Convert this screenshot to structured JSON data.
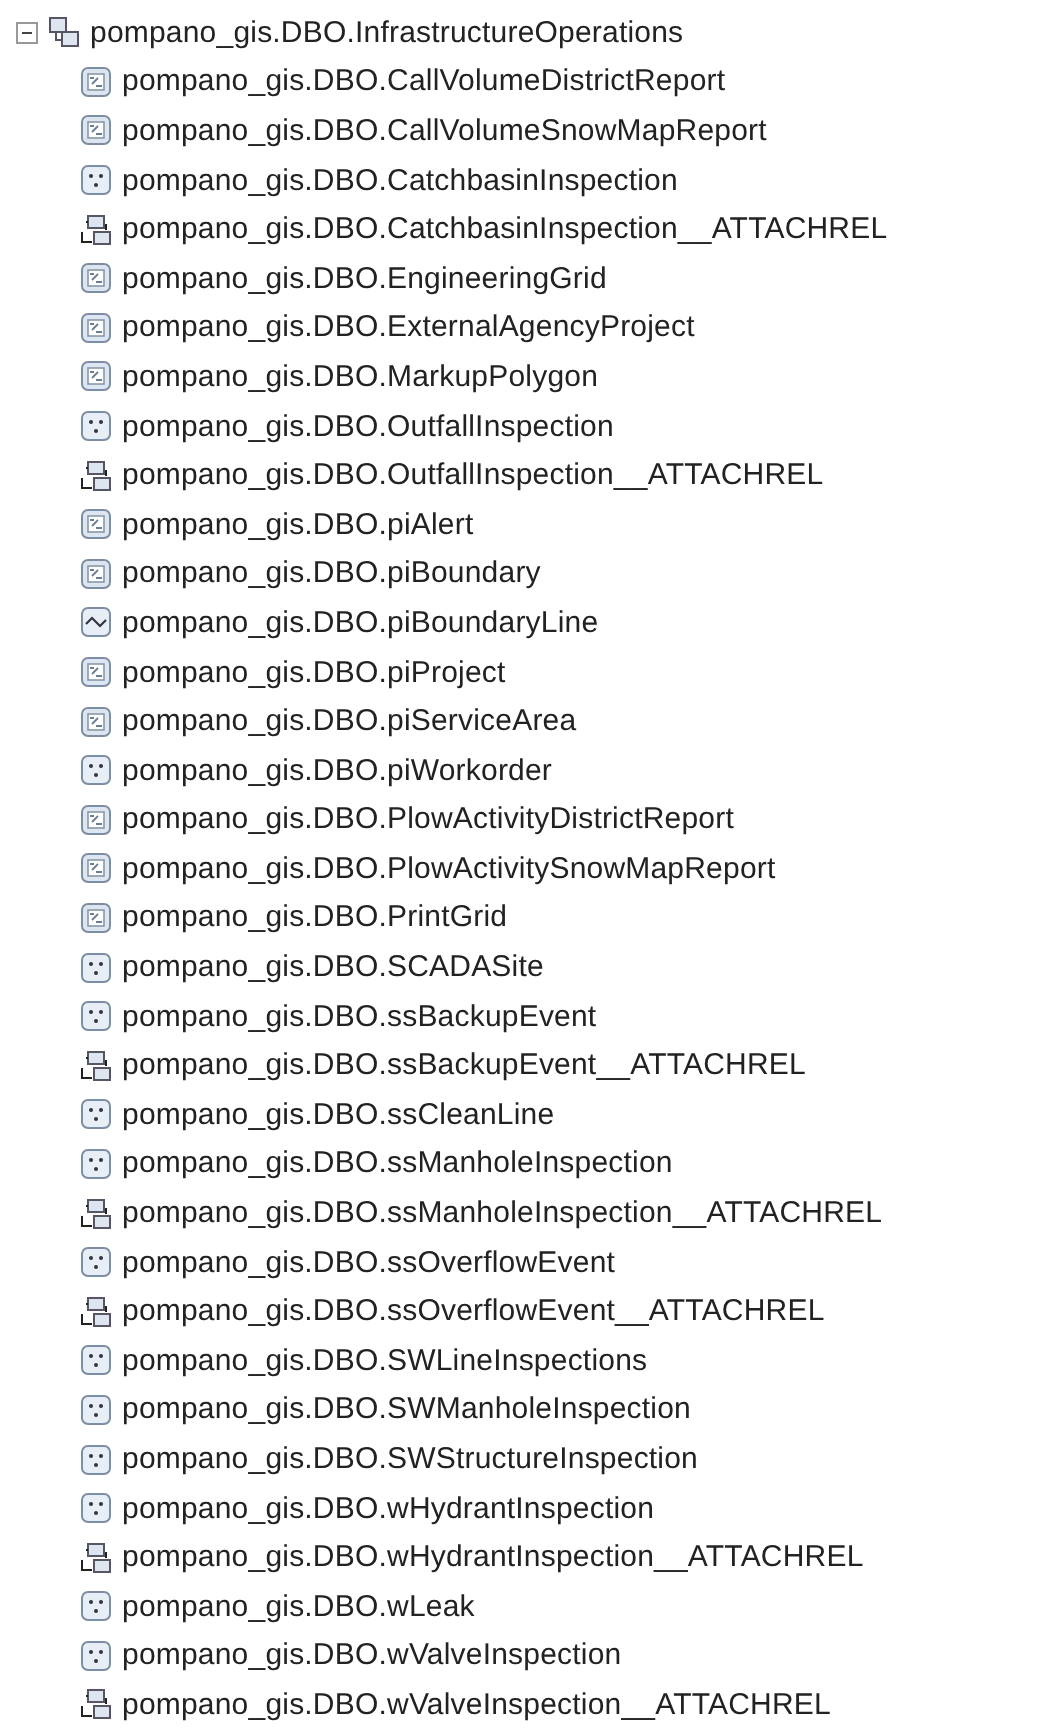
{
  "tree": {
    "label": "pompano_gis.DBO.InfrastructureOperations",
    "kind": "dataset",
    "expanded": true,
    "children": [
      {
        "label": "pompano_gis.DBO.CallVolumeDistrictReport",
        "kind": "table"
      },
      {
        "label": "pompano_gis.DBO.CallVolumeSnowMapReport",
        "kind": "table"
      },
      {
        "label": "pompano_gis.DBO.CatchbasinInspection",
        "kind": "point"
      },
      {
        "label": "pompano_gis.DBO.CatchbasinInspection__ATTACHREL",
        "kind": "relationship"
      },
      {
        "label": "pompano_gis.DBO.EngineeringGrid",
        "kind": "table"
      },
      {
        "label": "pompano_gis.DBO.ExternalAgencyProject",
        "kind": "table"
      },
      {
        "label": "pompano_gis.DBO.MarkupPolygon",
        "kind": "table"
      },
      {
        "label": "pompano_gis.DBO.OutfallInspection",
        "kind": "point"
      },
      {
        "label": "pompano_gis.DBO.OutfallInspection__ATTACHREL",
        "kind": "relationship"
      },
      {
        "label": "pompano_gis.DBO.piAlert",
        "kind": "table"
      },
      {
        "label": "pompano_gis.DBO.piBoundary",
        "kind": "table"
      },
      {
        "label": "pompano_gis.DBO.piBoundaryLine",
        "kind": "line"
      },
      {
        "label": "pompano_gis.DBO.piProject",
        "kind": "table"
      },
      {
        "label": "pompano_gis.DBO.piServiceArea",
        "kind": "table"
      },
      {
        "label": "pompano_gis.DBO.piWorkorder",
        "kind": "point"
      },
      {
        "label": "pompano_gis.DBO.PlowActivityDistrictReport",
        "kind": "table"
      },
      {
        "label": "pompano_gis.DBO.PlowActivitySnowMapReport",
        "kind": "table"
      },
      {
        "label": "pompano_gis.DBO.PrintGrid",
        "kind": "table"
      },
      {
        "label": "pompano_gis.DBO.SCADASite",
        "kind": "point"
      },
      {
        "label": "pompano_gis.DBO.ssBackupEvent",
        "kind": "point"
      },
      {
        "label": "pompano_gis.DBO.ssBackupEvent__ATTACHREL",
        "kind": "relationship"
      },
      {
        "label": "pompano_gis.DBO.ssCleanLine",
        "kind": "point"
      },
      {
        "label": "pompano_gis.DBO.ssManholeInspection",
        "kind": "point"
      },
      {
        "label": "pompano_gis.DBO.ssManholeInspection__ATTACHREL",
        "kind": "relationship"
      },
      {
        "label": "pompano_gis.DBO.ssOverflowEvent",
        "kind": "point"
      },
      {
        "label": "pompano_gis.DBO.ssOverflowEvent__ATTACHREL",
        "kind": "relationship"
      },
      {
        "label": "pompano_gis.DBO.SWLineInspections",
        "kind": "point"
      },
      {
        "label": "pompano_gis.DBO.SWManholeInspection",
        "kind": "point"
      },
      {
        "label": "pompano_gis.DBO.SWStructureInspection",
        "kind": "point"
      },
      {
        "label": "pompano_gis.DBO.wHydrantInspection",
        "kind": "point"
      },
      {
        "label": "pompano_gis.DBO.wHydrantInspection__ATTACHREL",
        "kind": "relationship"
      },
      {
        "label": "pompano_gis.DBO.wLeak",
        "kind": "point"
      },
      {
        "label": "pompano_gis.DBO.wValveInspection",
        "kind": "point"
      },
      {
        "label": "pompano_gis.DBO.wValveInspection__ATTACHREL",
        "kind": "relationship"
      }
    ]
  }
}
